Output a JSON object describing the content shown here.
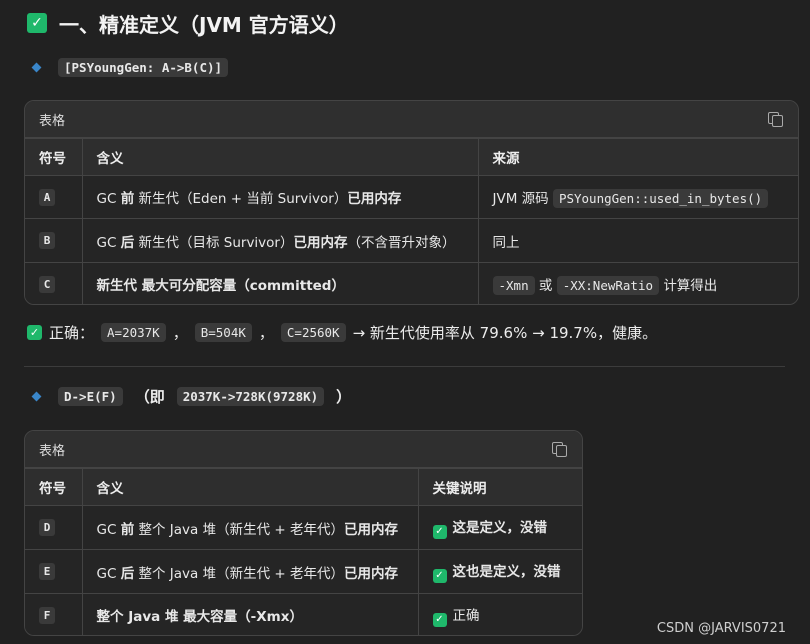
{
  "heading": {
    "title": "一、精准定义（JVM 官方语义）"
  },
  "section1": {
    "code": "[PSYoungGen: A->B(C)]",
    "card_title": "表格",
    "headers": [
      "符号",
      "含义",
      "来源"
    ],
    "rows": [
      {
        "letter": "A",
        "m1": "GC ",
        "m2": "前",
        "m3": " 新生代（Eden + 当前 Survivor）",
        "m4": "已用内存",
        "m5": "",
        "src_text": "JVM 源码",
        "src_code": "PSYoungGen::used_in_bytes()"
      },
      {
        "letter": "B",
        "m1": "GC ",
        "m2": "后",
        "m3": " 新生代（目标 Survivor）",
        "m4": "已用内存",
        "m5": "（不含晋升对象）",
        "src_text": "同上"
      },
      {
        "letter": "C",
        "m1": "新生代 ",
        "m2": "最大可分配容量（committed）",
        "src_code1": "-Xmn",
        "src_mid": "或",
        "src_code2": "-XX:NewRatio",
        "src_tail": "计算得出"
      }
    ]
  },
  "result": {
    "prefix": "正确：",
    "a": "A=2037K",
    "b": "B=504K",
    "c": "C=2560K",
    "sep": "，",
    "tail": "→ 新生代使用率从 79.6% → 19.7%，健康。"
  },
  "section2": {
    "code1": "D->E(F)",
    "mid_open": "（即",
    "code2": "2037K->728K(9728K)",
    "close": "）",
    "card_title": "表格",
    "headers": [
      "符号",
      "含义",
      "关键说明"
    ],
    "rows": [
      {
        "letter": "D",
        "m1": "GC ",
        "m2": "前",
        "m3": " 整个 Java 堆（新生代 + 老年代）",
        "m4": "已用内存",
        "note": "这是定义，没错"
      },
      {
        "letter": "E",
        "m1": "GC ",
        "m2": "后",
        "m3": " 整个 Java 堆（新生代 + 老年代）",
        "m4": "已用内存",
        "note": "这也是定义，没错"
      },
      {
        "letter": "F",
        "m1": "整个 Java 堆 ",
        "m2": "最大容量（-Xmx）",
        "note": "正确"
      }
    ]
  },
  "watermark": "CSDN @JARVIS0721",
  "colors": {
    "background": "#212121",
    "check": "#1fb86b",
    "diamond": "#3a86c9"
  },
  "icons": {
    "check": "check-icon",
    "copy": "copy-icon",
    "bullet": "diamond-icon"
  }
}
